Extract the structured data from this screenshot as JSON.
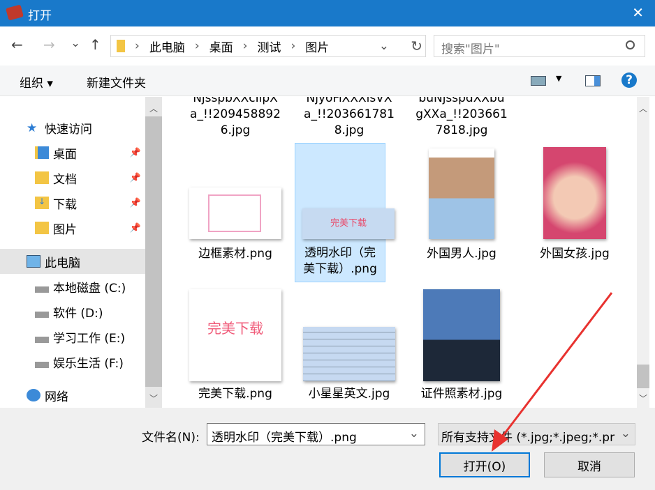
{
  "window": {
    "title": "打开",
    "close": "✕"
  },
  "nav": {
    "back": "←",
    "forward": "→",
    "dropdown": "⌄",
    "up": "↑",
    "breadcrumb": [
      "此电脑",
      "桌面",
      "测试",
      "图片"
    ],
    "refresh": "↻",
    "search_placeholder": "搜索\"图片\""
  },
  "toolbar": {
    "organize": "组织 ▾",
    "new_folder": "新建文件夹",
    "help": "?"
  },
  "sidebar": {
    "quick_access": "快速访问",
    "items": [
      {
        "label": "桌面"
      },
      {
        "label": "文档"
      },
      {
        "label": "下载"
      },
      {
        "label": "图片"
      }
    ],
    "this_pc": "此电脑",
    "drives": [
      {
        "label": "本地磁盘 (C:)"
      },
      {
        "label": "软件 (D:)"
      },
      {
        "label": "学习工作 (E:)"
      },
      {
        "label": "娱乐生活 (F:)"
      }
    ],
    "network": "网络"
  },
  "files": {
    "row0": [
      {
        "line0": "NjsspbXXcIipX",
        "line1": "a_!!209458892",
        "line2": "6.jpg"
      },
      {
        "line0": "NjyoFiXXXisVX",
        "line1": "a_!!203661781",
        "line2": "8.jpg"
      },
      {
        "line0": "buNjsspdXXbu",
        "line1": "gXXa_!!203661",
        "line2": "7818.jpg"
      }
    ],
    "row1": [
      {
        "name": "边框素材.png"
      },
      {
        "name": "透明水印（完美下载）.png",
        "thumb_text": "完美下载"
      },
      {
        "name": "外国男人.jpg"
      },
      {
        "name": "外国女孩.jpg"
      }
    ],
    "row2": [
      {
        "name": "完美下载.png",
        "thumb_text": "完美下载"
      },
      {
        "name": "小星星英文.jpg"
      },
      {
        "name": "证件照素材.jpg"
      }
    ]
  },
  "bottom": {
    "filename_label": "文件名(N):",
    "filename_value": "透明水印（完美下载）.png",
    "filter": "所有支持文件 (*.jpg;*.jpeg;*.pr",
    "open": "打开(O)",
    "cancel": "取消"
  },
  "colors": {
    "title": "#1979ca",
    "selected": "#cce8ff",
    "arrow": "#e8322f"
  }
}
